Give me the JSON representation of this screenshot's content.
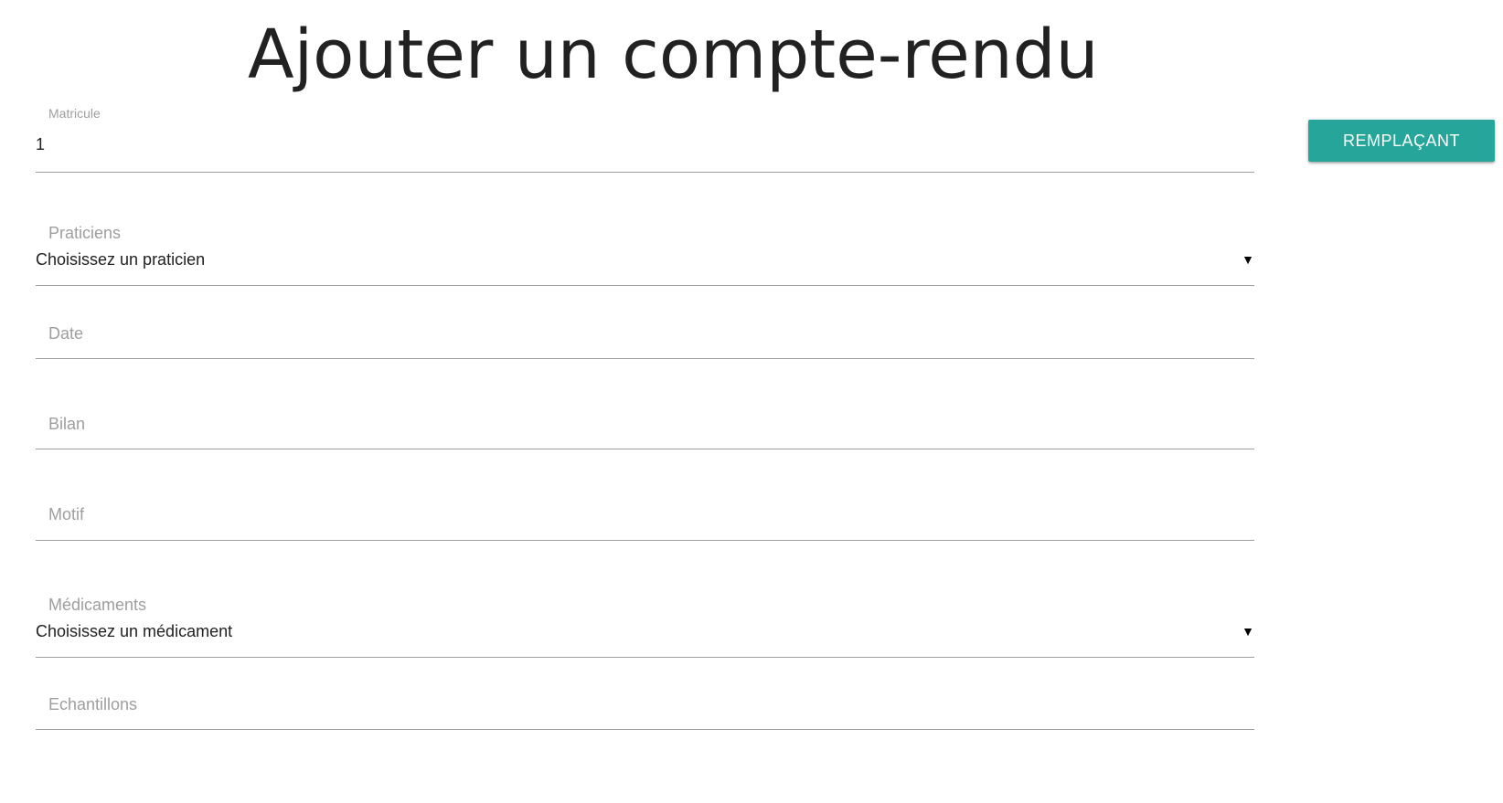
{
  "page": {
    "title": "Ajouter un compte-rendu"
  },
  "form": {
    "matricule": {
      "label": "Matricule",
      "value": "1"
    },
    "praticiens": {
      "label": "Praticiens",
      "selected": "Choisissez un praticien"
    },
    "date": {
      "label": "Date"
    },
    "bilan": {
      "label": "Bilan"
    },
    "motif": {
      "label": "Motif"
    },
    "medicaments": {
      "label": "Médicaments",
      "selected": "Choisissez un médicament"
    },
    "echantillons": {
      "label": "Echantillons"
    }
  },
  "actions": {
    "replace_label": "REMPLAÇANT"
  },
  "icons": {
    "dropdown": "caret-down-icon"
  },
  "colors": {
    "accent": "#26a69a",
    "label": "#9e9e9e",
    "text": "#212121",
    "underline": "#9e9e9e"
  }
}
